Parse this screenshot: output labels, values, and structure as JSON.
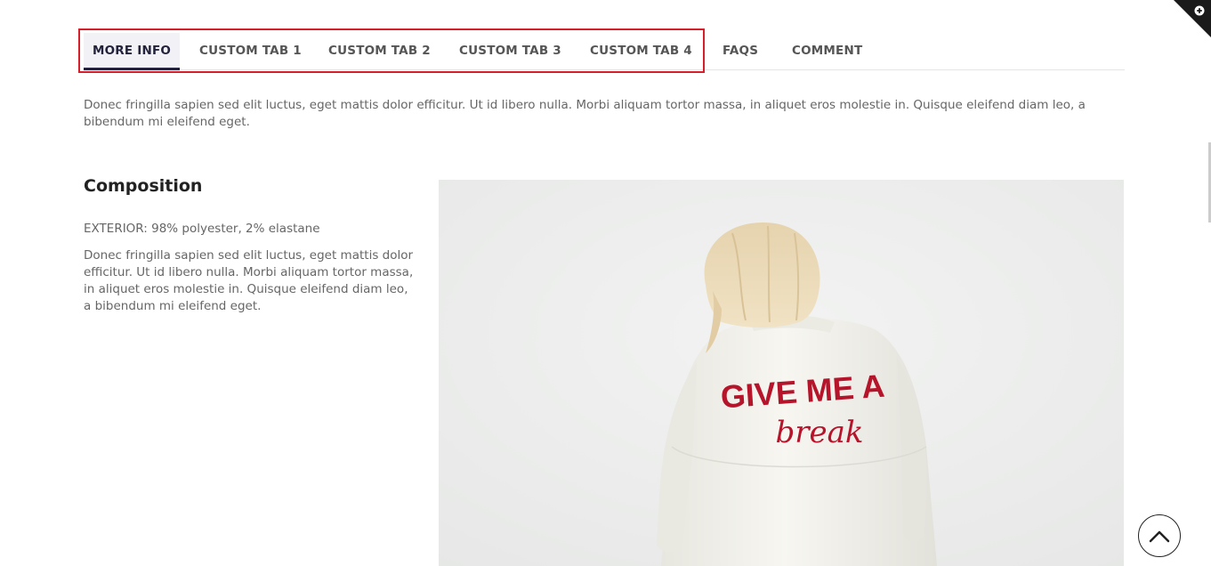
{
  "tabs": {
    "items": [
      {
        "label": "MORE INFO",
        "active": true
      },
      {
        "label": "CUSTOM TAB 1",
        "active": false
      },
      {
        "label": "CUSTOM TAB 2",
        "active": false
      },
      {
        "label": "CUSTOM TAB 3",
        "active": false
      },
      {
        "label": "CUSTOM TAB 4",
        "active": false
      },
      {
        "label": "FAQS",
        "active": false
      },
      {
        "label": "COMMENT",
        "active": false
      }
    ]
  },
  "content": {
    "intro": "Donec fringilla sapien sed elit luctus, eget mattis dolor efficitur. Ut id libero nulla. Morbi aliquam tortor massa, in aliquet eros molestie in. Quisque eleifend diam leo, a bibendum mi eleifend eget.",
    "composition": {
      "title": "Composition",
      "exterior": "EXTERIOR: 98% polyester, 2% elastane",
      "description": "Donec fringilla sapien sed elit luctus, eget mattis dolor efficitur. Ut id libero nulla. Morbi aliquam tortor massa, in aliquet eros molestie in. Quisque eleifend diam leo, a bibendum mi eleifend eget."
    },
    "image": {
      "jacket_text_top": "GIVE ME A",
      "jacket_text_script": "break"
    }
  },
  "colors": {
    "accent": "#22223c",
    "highlight": "#d71f2b",
    "jacket_text": "#b5142a"
  },
  "icons": {
    "corner": "plus-icon",
    "back_to_top": "chevron-up-icon"
  }
}
